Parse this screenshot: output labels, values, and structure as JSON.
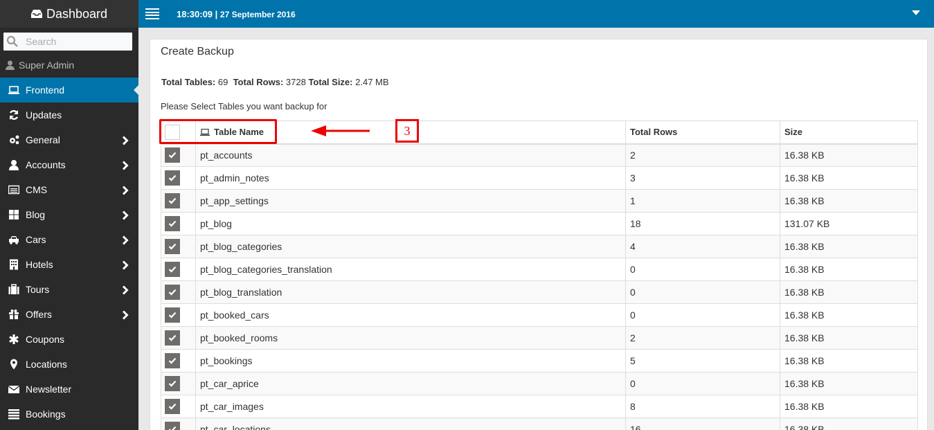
{
  "sidebar": {
    "brand": "Dashboard",
    "search_placeholder": "Search",
    "user": "Super Admin",
    "items": [
      {
        "label": "Frontend",
        "icon": "laptop-icon",
        "active": true,
        "has_submenu": false
      },
      {
        "label": "Updates",
        "icon": "refresh-icon",
        "active": false,
        "has_submenu": false
      },
      {
        "label": "General",
        "icon": "gears-icon",
        "active": false,
        "has_submenu": true
      },
      {
        "label": "Accounts",
        "icon": "user-icon",
        "active": false,
        "has_submenu": true
      },
      {
        "label": "CMS",
        "icon": "list-alt-icon",
        "active": false,
        "has_submenu": true
      },
      {
        "label": "Blog",
        "icon": "th-large-icon",
        "active": false,
        "has_submenu": true
      },
      {
        "label": "Cars",
        "icon": "car-icon",
        "active": false,
        "has_submenu": true
      },
      {
        "label": "Hotels",
        "icon": "building-icon",
        "active": false,
        "has_submenu": true
      },
      {
        "label": "Tours",
        "icon": "suitcase-icon",
        "active": false,
        "has_submenu": true
      },
      {
        "label": "Offers",
        "icon": "gift-icon",
        "active": false,
        "has_submenu": true
      },
      {
        "label": "Coupons",
        "icon": "asterisk-icon",
        "active": false,
        "has_submenu": false
      },
      {
        "label": "Locations",
        "icon": "map-marker-icon",
        "active": false,
        "has_submenu": false
      },
      {
        "label": "Newsletter",
        "icon": "envelope-icon",
        "active": false,
        "has_submenu": false
      },
      {
        "label": "Bookings",
        "icon": "list-icon",
        "active": false,
        "has_submenu": false
      }
    ]
  },
  "topbar": {
    "time": "18:30:09",
    "separator": " | ",
    "date": "27 September 2016"
  },
  "panel": {
    "title": "Create Backup",
    "totals": {
      "tables_label": "Total Tables:",
      "tables_value": "69",
      "rows_label": "Total Rows:",
      "rows_value": "3728",
      "size_label": "Total Size:",
      "size_value": "2.47 MB"
    },
    "instruction": "Please Select Tables you want backup for",
    "table": {
      "headers": {
        "name": "Table Name",
        "rows": "Total Rows",
        "size": "Size"
      },
      "select_all_checked": false,
      "rows": [
        {
          "name": "pt_accounts",
          "rows": "2",
          "size": "16.38 KB",
          "checked": true
        },
        {
          "name": "pt_admin_notes",
          "rows": "3",
          "size": "16.38 KB",
          "checked": true
        },
        {
          "name": "pt_app_settings",
          "rows": "1",
          "size": "16.38 KB",
          "checked": true
        },
        {
          "name": "pt_blog",
          "rows": "18",
          "size": "131.07 KB",
          "checked": true
        },
        {
          "name": "pt_blog_categories",
          "rows": "4",
          "size": "16.38 KB",
          "checked": true
        },
        {
          "name": "pt_blog_categories_translation",
          "rows": "0",
          "size": "16.38 KB",
          "checked": true
        },
        {
          "name": "pt_blog_translation",
          "rows": "0",
          "size": "16.38 KB",
          "checked": true
        },
        {
          "name": "pt_booked_cars",
          "rows": "0",
          "size": "16.38 KB",
          "checked": true
        },
        {
          "name": "pt_booked_rooms",
          "rows": "2",
          "size": "16.38 KB",
          "checked": true
        },
        {
          "name": "pt_bookings",
          "rows": "5",
          "size": "16.38 KB",
          "checked": true
        },
        {
          "name": "pt_car_aprice",
          "rows": "0",
          "size": "16.38 KB",
          "checked": true
        },
        {
          "name": "pt_car_images",
          "rows": "8",
          "size": "16.38 KB",
          "checked": true
        },
        {
          "name": "pt_car_locations",
          "rows": "16",
          "size": "16.38 KB",
          "checked": true
        }
      ]
    }
  },
  "annotation": {
    "step_number": "3",
    "color": "#ee0000"
  },
  "colors": {
    "accent": "#0073aa",
    "sidebar_bg": "#2a2a2a",
    "checkbox_checked": "#6f6d69"
  }
}
